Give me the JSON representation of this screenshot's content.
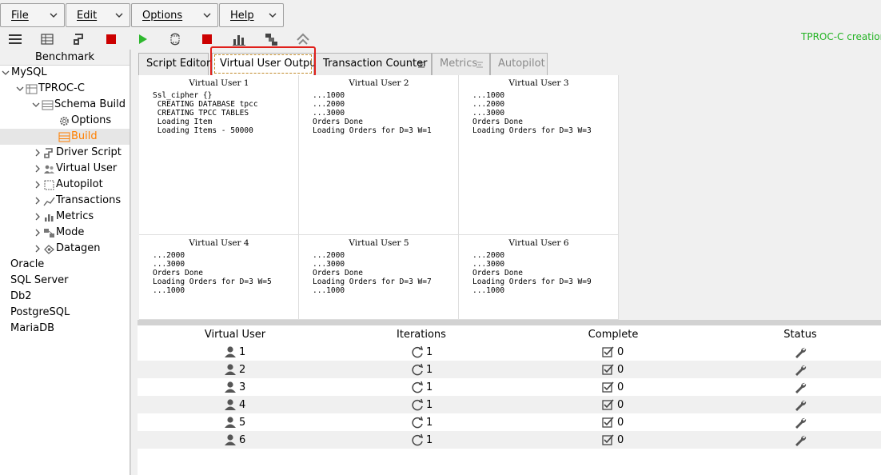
{
  "menubar": {
    "items": [
      {
        "label": "File"
      },
      {
        "label": "Edit"
      },
      {
        "label": "Options"
      },
      {
        "label": "Help"
      }
    ]
  },
  "toolbar": {
    "icons": [
      "menu-icon",
      "schema-icon",
      "driver-script-icon",
      "stop-icon",
      "run-icon",
      "vuser-icon",
      "stop-vuser-icon",
      "transactions-chart-icon",
      "metrics-icon",
      "autopilot-icon"
    ],
    "status_text": "TPROC-C creation"
  },
  "tree": {
    "header": "Benchmark",
    "nodes": {
      "mysql": "MySQL",
      "tprocc": "TPROC-C",
      "schema_build": "Schema Build",
      "options": "Options",
      "build": "Build",
      "driver_script": "Driver Script",
      "virtual_user": "Virtual User",
      "autopilot": "Autopilot",
      "transactions": "Transactions",
      "metrics": "Metrics",
      "mode": "Mode",
      "datagen": "Datagen",
      "oracle": "Oracle",
      "sql_server": "SQL Server",
      "db2": "Db2",
      "postgresql": "PostgreSQL",
      "mariadb": "MariaDB"
    },
    "selected": "Build"
  },
  "tabs": [
    {
      "label": "Script Editor",
      "state": "normal"
    },
    {
      "label": "Virtual User Output",
      "state": "active"
    },
    {
      "label": "Transaction Counter",
      "state": "normal"
    },
    {
      "label": "Metrics",
      "state": "disabled"
    },
    {
      "label": "Autopilot",
      "state": "disabled"
    }
  ],
  "outputs": [
    {
      "title": "Virtual User 1",
      "text": "Ssl_cipher {}\n CREATING DATABASE tpcc\n CREATING TPCC TABLES\n Loading Item\n Loading Items - 50000"
    },
    {
      "title": "Virtual User 2",
      "text": "...1000\n...2000\n...3000\nOrders Done\nLoading Orders for D=3 W=1"
    },
    {
      "title": "Virtual User 3",
      "text": "...1000\n...2000\n...3000\nOrders Done\nLoading Orders for D=3 W=3"
    },
    {
      "title": "Virtual User 4",
      "text": "...2000\n...3000\nOrders Done\nLoading Orders for D=3 W=5\n...1000"
    },
    {
      "title": "Virtual User 5",
      "text": "...2000\n...3000\nOrders Done\nLoading Orders for D=3 W=7\n...1000"
    },
    {
      "title": "Virtual User 6",
      "text": "...2000\n...3000\nOrders Done\nLoading Orders for D=3 W=9\n...1000"
    }
  ],
  "table": {
    "headers": {
      "vuser": "Virtual User",
      "iterations": "Iterations",
      "complete": "Complete",
      "status": "Status"
    },
    "rows": [
      {
        "vuser": "1",
        "iterations": "1",
        "complete": "0"
      },
      {
        "vuser": "2",
        "iterations": "1",
        "complete": "0"
      },
      {
        "vuser": "3",
        "iterations": "1",
        "complete": "0"
      },
      {
        "vuser": "4",
        "iterations": "1",
        "complete": "0"
      },
      {
        "vuser": "5",
        "iterations": "1",
        "complete": "0"
      },
      {
        "vuser": "6",
        "iterations": "1",
        "complete": "0"
      }
    ]
  },
  "colors": {
    "status_text": "#23b323",
    "selected_item": "#ff7f00",
    "highlight_frame": "#e0201b",
    "stop": "#cc0000",
    "run": "#2eb82e"
  }
}
